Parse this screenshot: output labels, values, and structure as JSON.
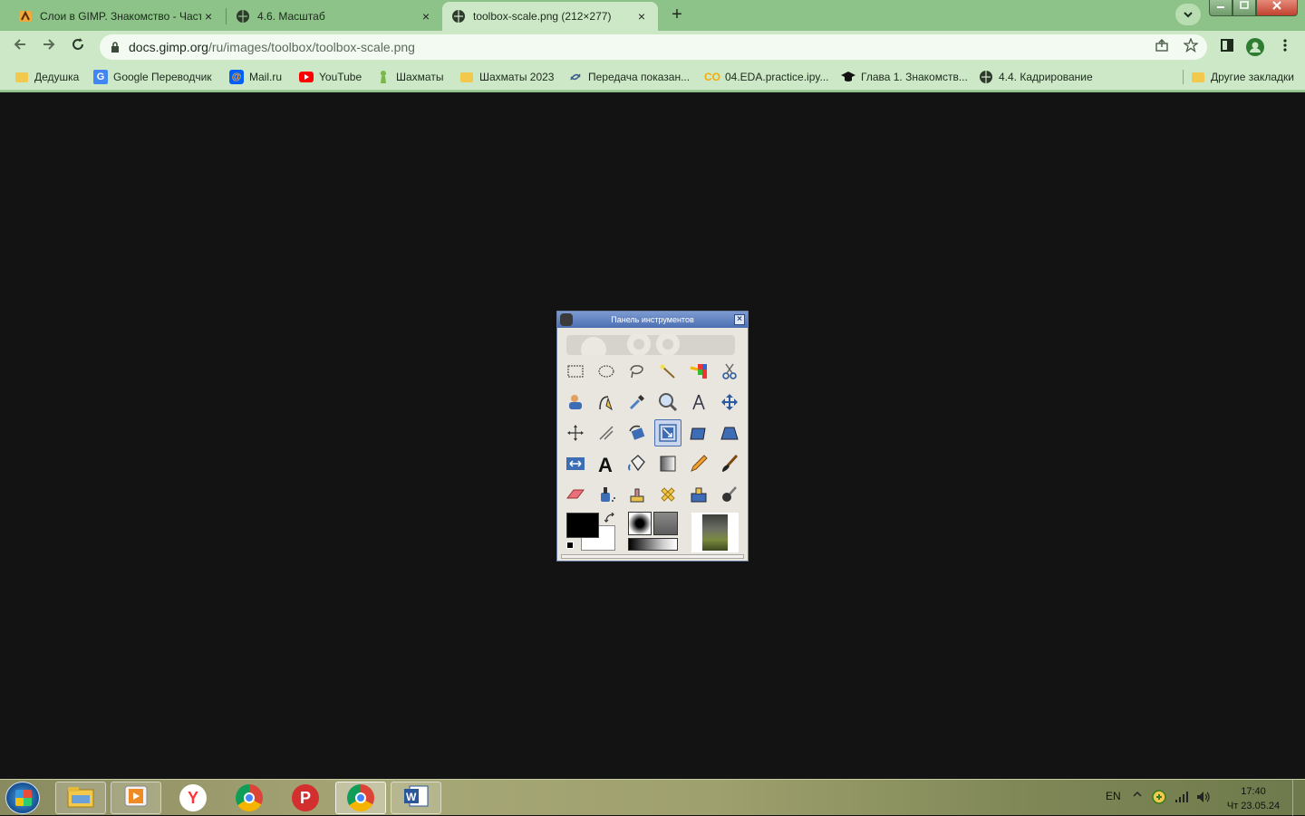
{
  "browser": {
    "tabs": [
      {
        "title": "Слои в GIMP. Знакомство - Част",
        "active": false
      },
      {
        "title": "4.6. Масштаб",
        "active": false
      },
      {
        "title": "toolbox-scale.png (212×277)",
        "active": true
      }
    ],
    "new_tab_label": "+",
    "close_glyph": "×",
    "address": {
      "host": "docs.gimp.org",
      "path": "/ru/images/toolbox/toolbox-scale.png"
    },
    "bookmarks": [
      {
        "label": "Дедушка",
        "icon": "folder-icon"
      },
      {
        "label": "Google Переводчик",
        "icon": "google-translate-icon"
      },
      {
        "label": "Mail.ru",
        "icon": "mailru-icon"
      },
      {
        "label": "YouTube",
        "icon": "youtube-icon"
      },
      {
        "label": "Шахматы",
        "icon": "chess-icon"
      },
      {
        "label": "Шахматы 2023",
        "icon": "folder-icon"
      },
      {
        "label": "Передача показан...",
        "icon": "link-icon"
      },
      {
        "label": "04.EDA.practice.ipy...",
        "icon": "colab-icon"
      },
      {
        "label": "Глава 1. Знакомств...",
        "icon": "graduation-cap-icon"
      },
      {
        "label": "4.4. Кадрирование",
        "icon": "globe-icon"
      }
    ],
    "other_bookmarks": "Другие закладки",
    "colors": {
      "frame": "#8dc289",
      "toolbar": "#cde8c7",
      "viewer_bg": "#131313"
    }
  },
  "gimp_image": {
    "title": "Панель инструментов",
    "selected_tool": "scale-tool"
  },
  "taskbar": {
    "language": "EN",
    "time": "17:40",
    "date": "Чт 23.05.24"
  }
}
